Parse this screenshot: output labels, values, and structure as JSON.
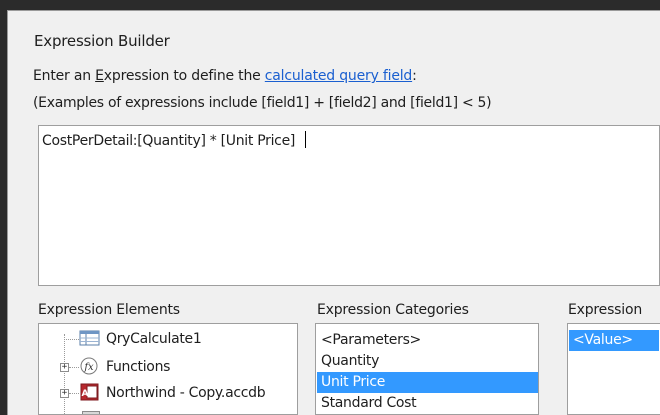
{
  "dialog": {
    "title": "Expression Builder",
    "instruction_prefix": "Enter an ",
    "instruction_mnemonic": "E",
    "instruction_mid": "xpression to define the ",
    "instruction_link": "calculated query field",
    "instruction_suffix": ":",
    "examples": "(Examples of expressions include [field1] + [field2] and [field1] < 5)"
  },
  "expression": {
    "value": "CostPerDetail:[Quantity] * [Unit Price] "
  },
  "elements_panel": {
    "label": "Expression Elements",
    "items": [
      {
        "label": "QryCalculate1",
        "icon": "query-icon",
        "expandable": false
      },
      {
        "label": "Functions",
        "icon": "function-icon",
        "expandable": true
      },
      {
        "label": "Northwind - Copy.accdb",
        "icon": "database-icon",
        "expandable": true
      }
    ]
  },
  "categories_panel": {
    "label": "Expression Categories",
    "items": [
      "<Parameters>",
      "Quantity",
      "Unit Price",
      "Standard Cost"
    ],
    "selected": "Unit Price"
  },
  "values_panel": {
    "label": "Expression",
    "items": [
      "<Value>"
    ]
  },
  "colors": {
    "selection": "#3399ff",
    "link": "#1a5fd0",
    "dialog_bg": "#f0f0f0"
  }
}
